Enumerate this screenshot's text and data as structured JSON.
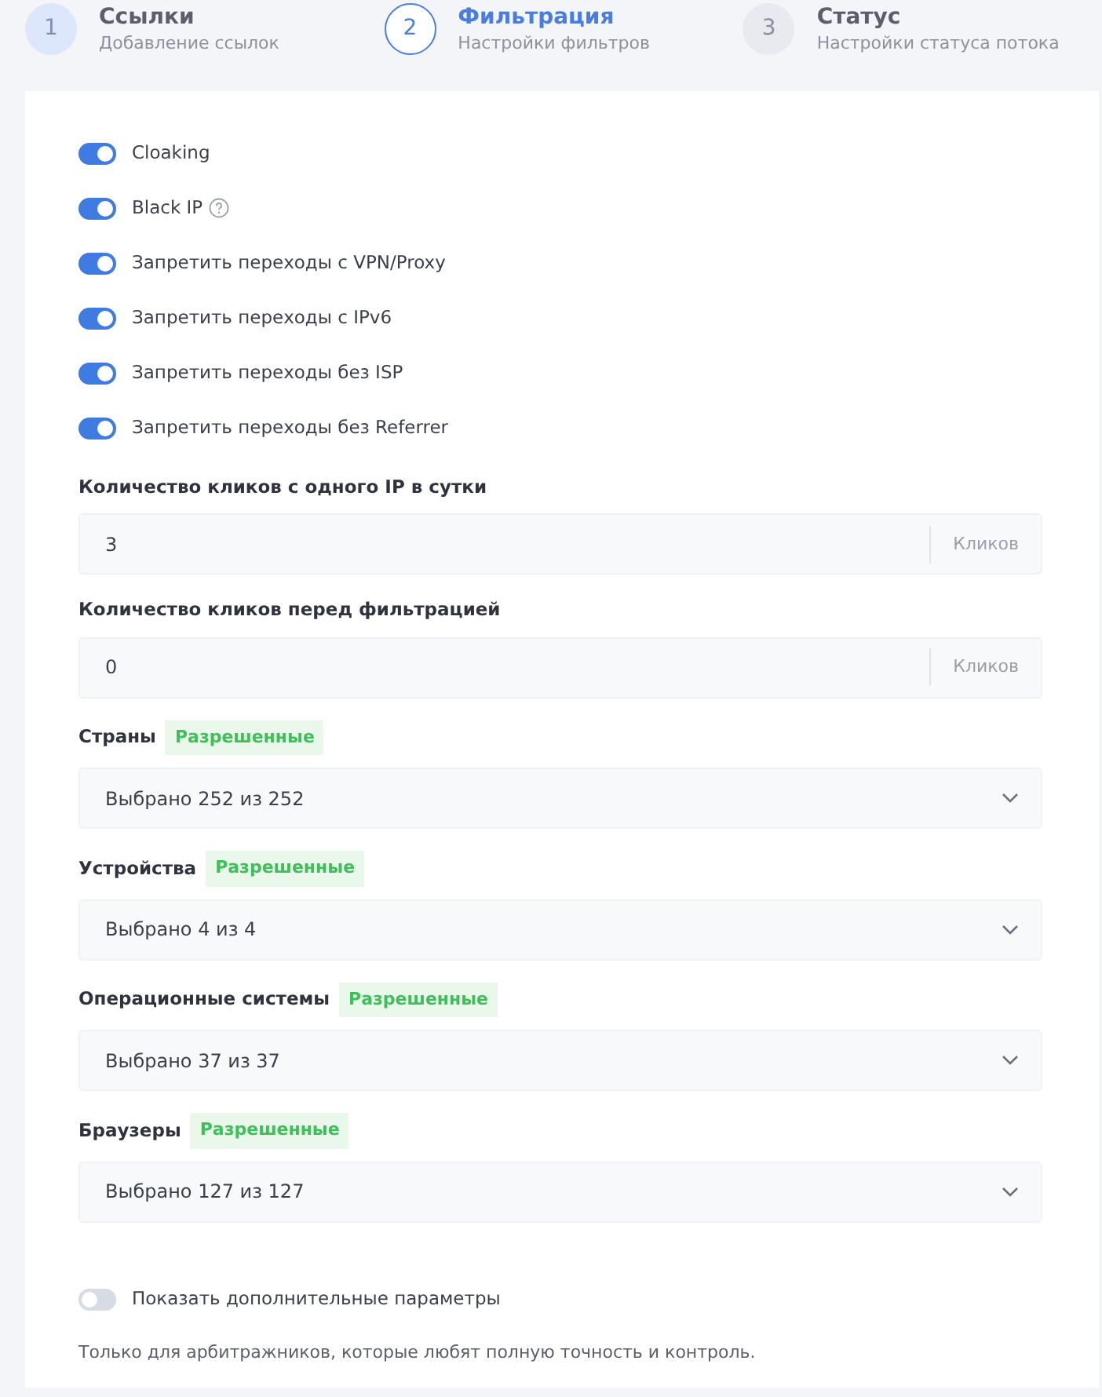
{
  "steps": [
    {
      "number": "1",
      "title": "Ссылки",
      "subtitle": "Добавление ссылок",
      "selected": false,
      "completed": true
    },
    {
      "number": "2",
      "title": "Фильтрация",
      "subtitle": "Настройки фильтров",
      "selected": true,
      "completed": false
    },
    {
      "number": "3",
      "title": "Статус",
      "subtitle": "Настройки статуса потока",
      "selected": false,
      "completed": false
    }
  ],
  "toggles": [
    {
      "label": "Cloaking",
      "on": true,
      "help": false
    },
    {
      "label": "Black IP",
      "on": true,
      "help": true
    },
    {
      "label": "Запретить переходы с VPN/Proxy",
      "on": true,
      "help": false
    },
    {
      "label": "Запретить переходы с IPv6",
      "on": true,
      "help": false
    },
    {
      "label": "Запретить переходы без ISP",
      "on": true,
      "help": false
    },
    {
      "label": "Запретить переходы без Referrer",
      "on": true,
      "help": false
    }
  ],
  "number_fields": [
    {
      "label": "Количество кликов с одного IP в сутки",
      "value": "3",
      "unit": "Кликов"
    },
    {
      "label": "Количество кликов перед фильтрацией",
      "value": "0",
      "unit": "Кликов"
    }
  ],
  "selects": [
    {
      "label": "Страны",
      "badge": "Разрешенные",
      "value": "Выбрано 252 из 252"
    },
    {
      "label": "Устройства",
      "badge": "Разрешенные",
      "value": "Выбрано 4 из 4"
    },
    {
      "label": "Операционные системы",
      "badge": "Разрешенные",
      "value": "Выбрано 37 из 37"
    },
    {
      "label": "Браузеры",
      "badge": "Разрешенные",
      "value": "Выбрано 127 из 127"
    }
  ],
  "advanced": {
    "label": "Показать дополнительные параметры",
    "on": false,
    "note": "Только для арбитражников, которые любят полную точность и контроль."
  }
}
